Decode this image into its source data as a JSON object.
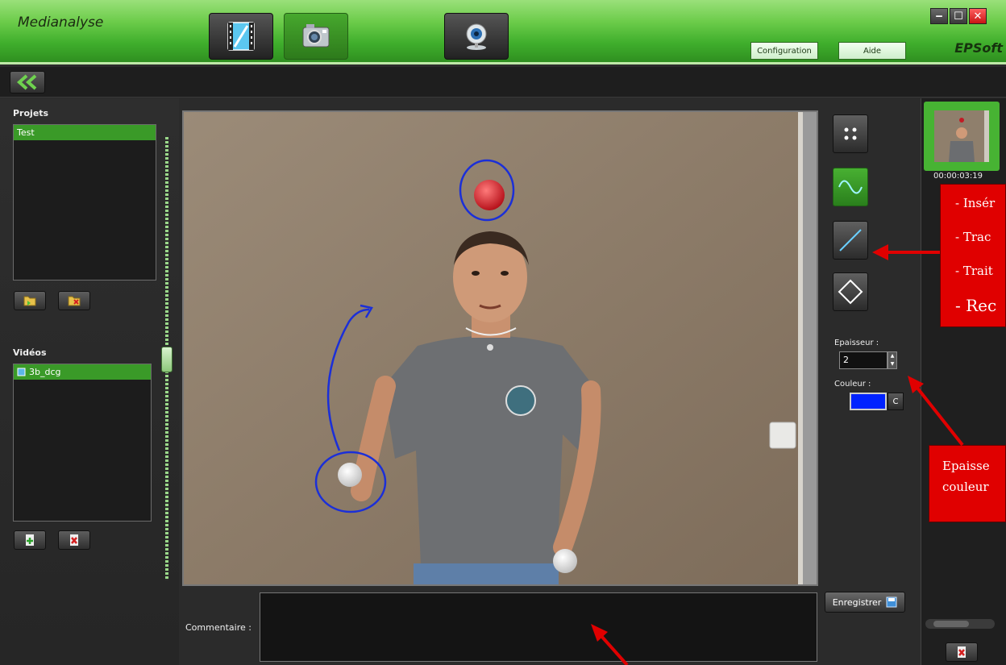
{
  "window": {
    "title": "Medianalyse",
    "brand": "EPSoft",
    "controls": {
      "minimize": "‒",
      "maximize": "☐",
      "close": "✕"
    }
  },
  "header": {
    "config_label": "Configuration",
    "help_label": "Aide"
  },
  "projects": {
    "label": "Projets",
    "items": [
      "Test"
    ]
  },
  "videos": {
    "label": "Vidéos",
    "items": [
      "3b_dcg"
    ]
  },
  "tools": {
    "thickness_label": "Epaisseur :",
    "thickness_value": "2",
    "color_label": "Couleur :",
    "color_value": "#0022ff",
    "color_button": "C",
    "save_label": "Enregistrer"
  },
  "comment": {
    "label": "Commentaire :"
  },
  "snapshots": {
    "items": [
      {
        "timestamp": "00:00:03:19"
      }
    ]
  },
  "annotations": {
    "tools_callout": [
      "- Insér",
      "- Trac",
      "- Trait",
      "- Rec"
    ],
    "props_callout": [
      "Epaisse",
      "couleur"
    ]
  },
  "colors": {
    "accent_green": "#3a9a28",
    "annotation_red": "#e00000",
    "drawing_blue": "#0022ff"
  }
}
